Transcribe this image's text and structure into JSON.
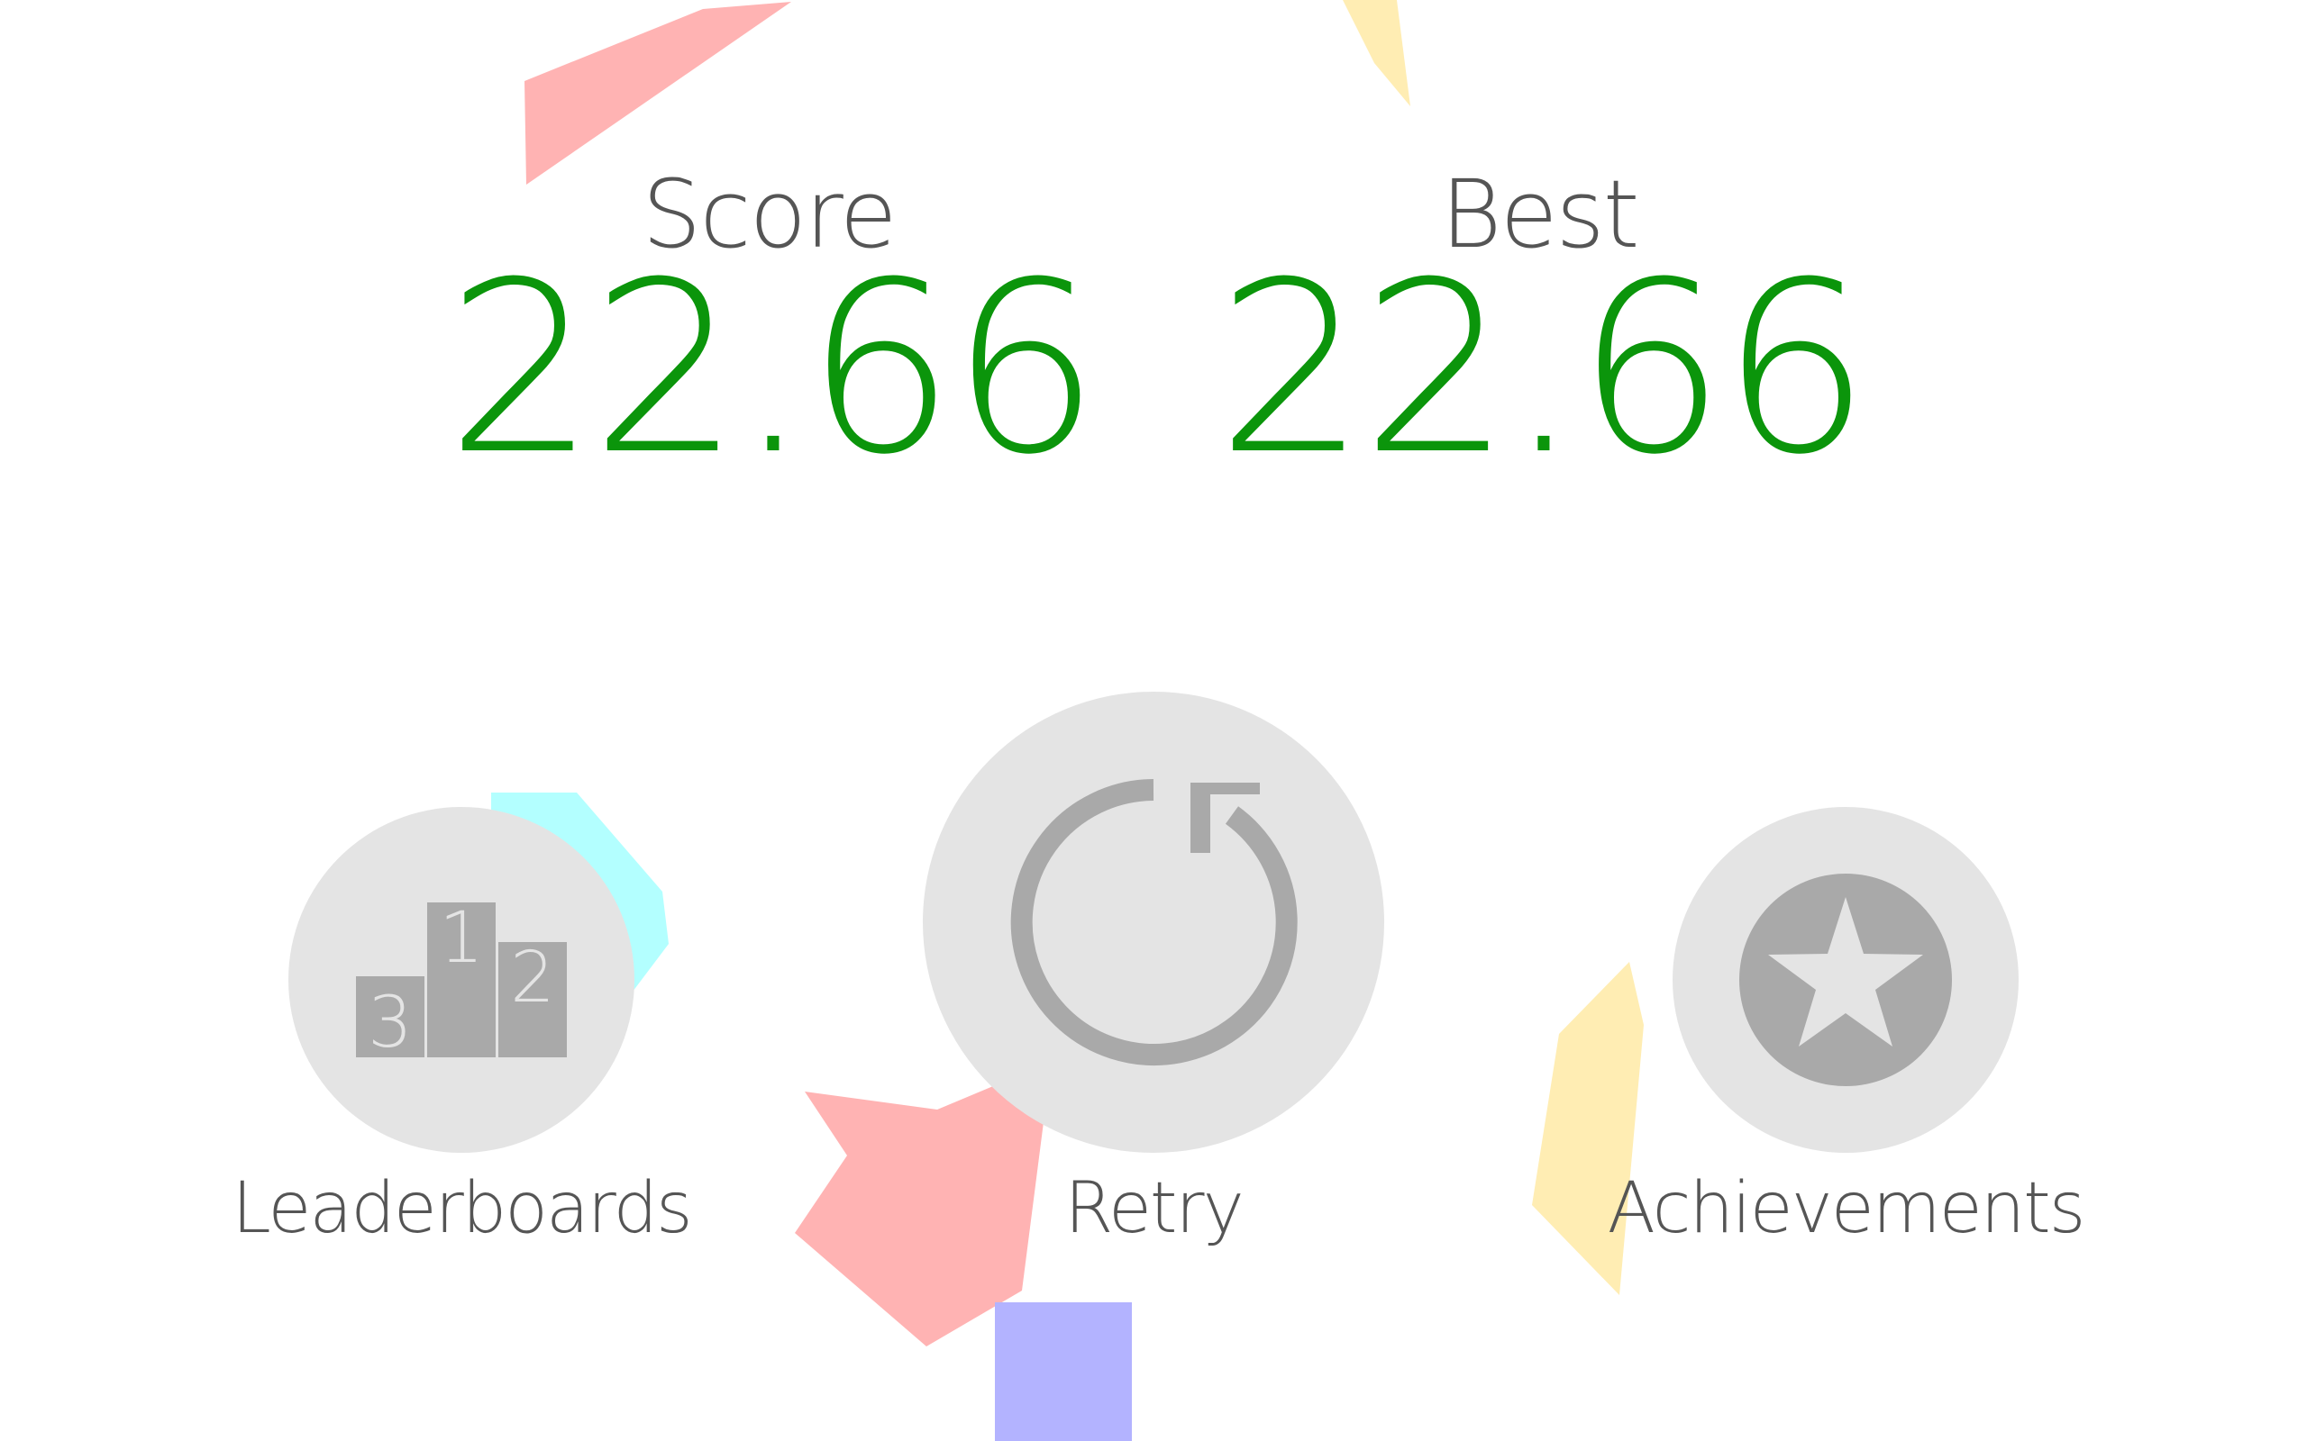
{
  "score": {
    "label": "Score",
    "value": "22.66"
  },
  "best": {
    "label": "Best",
    "value": "22.66"
  },
  "buttons": {
    "leaderboards": {
      "label": "Leaderboards",
      "icon": "podium-icon",
      "podium_places": [
        "1",
        "2",
        "3"
      ]
    },
    "retry": {
      "label": "Retry",
      "icon": "retry-icon"
    },
    "achievements": {
      "label": "Achievements",
      "icon": "star-icon"
    }
  },
  "colors": {
    "background": "#ffffff",
    "score_value": "#0b950b",
    "label_text": "#555555",
    "button_fill": "#e4e4e4",
    "icon_fill": "#a9a9a9",
    "shape_pink": "#ffb3b3",
    "shape_yellow": "#ffedb3",
    "shape_cyan": "#b3ffff",
    "shape_blue": "#b3b3ff"
  }
}
